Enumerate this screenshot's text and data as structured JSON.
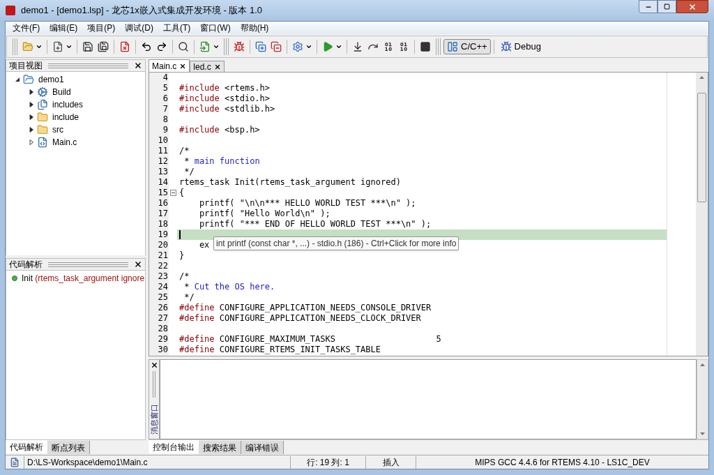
{
  "window": {
    "title": "demo1 - [demo1.lsp] - 龙芯1x嵌入式集成开发环境 - 版本 1.0"
  },
  "menu": [
    "文件(F)",
    "编辑(E)",
    "项目(P)",
    "调试(D)",
    "工具(T)",
    "窗口(W)",
    "帮助(H)"
  ],
  "perspectives": [
    {
      "label": "C/C++",
      "selected": true,
      "kind": "cpp"
    },
    {
      "label": "Debug",
      "selected": false,
      "kind": "debug"
    }
  ],
  "project_view": {
    "title": "项目视图",
    "tree": [
      {
        "label": "demo1",
        "kind": "project",
        "expanded": true,
        "children": [
          {
            "label": "Build",
            "kind": "build",
            "expanded": false
          },
          {
            "label": "includes",
            "kind": "includes",
            "expanded": false
          },
          {
            "label": "include",
            "kind": "folder",
            "expanded": false
          },
          {
            "label": "src",
            "kind": "folder",
            "expanded": false
          },
          {
            "label": "Main.c",
            "kind": "file",
            "expanded": false
          }
        ]
      }
    ]
  },
  "outline": {
    "title": "代码解析",
    "items": [
      {
        "name": "Init",
        "signature": "(rtems_task_argument ignore"
      }
    ]
  },
  "left_tabs": [
    {
      "label": "代码解析",
      "selected": true
    },
    {
      "label": "断点列表",
      "selected": false
    }
  ],
  "editor_tabs": [
    {
      "label": "Main.c",
      "selected": true
    },
    {
      "label": "led.c",
      "selected": false
    }
  ],
  "code_lines": [
    {
      "number": "4"
    },
    {
      "number": "5",
      "parts": [
        {
          "kind": "directive",
          "text": "#include"
        },
        {
          "kind": "plain",
          "text": " <rtems.h>"
        }
      ]
    },
    {
      "number": "6",
      "parts": [
        {
          "kind": "directive",
          "text": "#include"
        },
        {
          "kind": "plain",
          "text": " <stdio.h>"
        }
      ]
    },
    {
      "number": "7",
      "parts": [
        {
          "kind": "directive",
          "text": "#include"
        },
        {
          "kind": "plain",
          "text": " <stdlib.h>"
        }
      ]
    },
    {
      "number": "8"
    },
    {
      "number": "9",
      "parts": [
        {
          "kind": "directive",
          "text": "#include"
        },
        {
          "kind": "plain",
          "text": " <bsp.h>"
        }
      ]
    },
    {
      "number": "10"
    },
    {
      "number": "11",
      "parts": [
        {
          "kind": "plain",
          "text": "/*"
        }
      ]
    },
    {
      "number": "12",
      "parts": [
        {
          "kind": "plain",
          "text": " * "
        },
        {
          "kind": "comment",
          "text": "main function"
        }
      ]
    },
    {
      "number": "13",
      "parts": [
        {
          "kind": "plain",
          "text": " */"
        }
      ]
    },
    {
      "number": "14",
      "parts": [
        {
          "kind": "plain",
          "text": "rtems_task Init(rtems_task_argument ignored)"
        }
      ]
    },
    {
      "number": "15",
      "collapsible": true,
      "parts": [
        {
          "kind": "plain",
          "text": "{"
        }
      ]
    },
    {
      "number": "16",
      "parts": [
        {
          "kind": "plain",
          "text": "    printf( \"\\n\\n*** HELLO WORLD TEST ***\\n\" );"
        }
      ]
    },
    {
      "number": "17",
      "parts": [
        {
          "kind": "plain",
          "text": "    printf( \"Hello World\\n\" );"
        }
      ]
    },
    {
      "number": "18",
      "parts": [
        {
          "kind": "plain",
          "text": "    printf( \"*** END OF HELLO WORLD TEST ***\\n\" );"
        }
      ]
    },
    {
      "number": "19",
      "current": true
    },
    {
      "number": "20",
      "parts": [
        {
          "kind": "plain",
          "text": "    ex"
        }
      ]
    },
    {
      "number": "21",
      "parts": [
        {
          "kind": "plain",
          "text": "}"
        }
      ]
    },
    {
      "number": "22"
    },
    {
      "number": "23",
      "parts": [
        {
          "kind": "plain",
          "text": "/*"
        }
      ]
    },
    {
      "number": "24",
      "parts": [
        {
          "kind": "plain",
          "text": " * "
        },
        {
          "kind": "comment",
          "text": "Cut the OS here."
        }
      ]
    },
    {
      "number": "25",
      "parts": [
        {
          "kind": "plain",
          "text": " */"
        }
      ]
    },
    {
      "number": "26",
      "parts": [
        {
          "kind": "directive",
          "text": "#define"
        },
        {
          "kind": "plain",
          "text": " CONFIGURE_APPLICATION_NEEDS_CONSOLE_DRIVER"
        }
      ]
    },
    {
      "number": "27",
      "parts": [
        {
          "kind": "directive",
          "text": "#define"
        },
        {
          "kind": "plain",
          "text": " CONFIGURE_APPLICATION_NEEDS_CLOCK_DRIVER"
        }
      ]
    },
    {
      "number": "28"
    },
    {
      "number": "29",
      "parts": [
        {
          "kind": "directive",
          "text": "#define"
        },
        {
          "kind": "plain",
          "text": " CONFIGURE_MAXIMUM_TASKS                    5"
        }
      ]
    },
    {
      "number": "30",
      "parts": [
        {
          "kind": "directive",
          "text": "#define"
        },
        {
          "kind": "plain",
          "text": " CONFIGURE_RTEMS_INIT_TASKS_TABLE"
        }
      ]
    }
  ],
  "tooltip": "int printf (const char *, ...) - stdio.h (186) - Ctrl+Click for more info",
  "output": {
    "label": "消息窗口"
  },
  "output_tabs": [
    {
      "label": "控制台输出",
      "selected": true
    },
    {
      "label": "搜索结果",
      "selected": false
    },
    {
      "label": "编译错误",
      "selected": false
    }
  ],
  "status_bar": {
    "path": "D:\\LS-Workspace\\demo1\\Main.c",
    "position": "行: 19 列: 1",
    "mode": "插入",
    "toolchain": "MIPS GCC 4.4.6 for RTEMS 4.10 - LS1C_DEV"
  }
}
